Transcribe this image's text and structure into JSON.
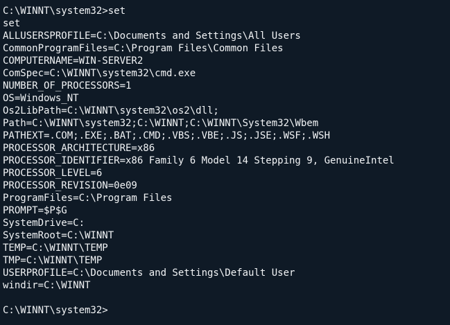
{
  "terminal": {
    "command_line": "C:\\WINNT\\system32>set",
    "echo": "set",
    "env": [
      "ALLUSERSPROFILE=C:\\Documents and Settings\\All Users",
      "CommonProgramFiles=C:\\Program Files\\Common Files",
      "COMPUTERNAME=WIN-SERVER2",
      "ComSpec=C:\\WINNT\\system32\\cmd.exe",
      "NUMBER_OF_PROCESSORS=1",
      "OS=Windows_NT",
      "Os2LibPath=C:\\WINNT\\system32\\os2\\dll;",
      "Path=C:\\WINNT\\system32;C:\\WINNT;C:\\WINNT\\System32\\Wbem",
      "PATHEXT=.COM;.EXE;.BAT;.CMD;.VBS;.VBE;.JS;.JSE;.WSF;.WSH",
      "PROCESSOR_ARCHITECTURE=x86",
      "PROCESSOR_IDENTIFIER=x86 Family 6 Model 14 Stepping 9, GenuineIntel",
      "PROCESSOR_LEVEL=6",
      "PROCESSOR_REVISION=0e09",
      "ProgramFiles=C:\\Program Files",
      "PROMPT=$P$G",
      "SystemDrive=C:",
      "SystemRoot=C:\\WINNT",
      "TEMP=C:\\WINNT\\TEMP",
      "TMP=C:\\WINNT\\TEMP",
      "USERPROFILE=C:\\Documents and Settings\\Default User",
      "windir=C:\\WINNT"
    ],
    "prompt": "C:\\WINNT\\system32>",
    "colors": {
      "background": "#0f1a26",
      "text": "#f2f4f6"
    }
  }
}
